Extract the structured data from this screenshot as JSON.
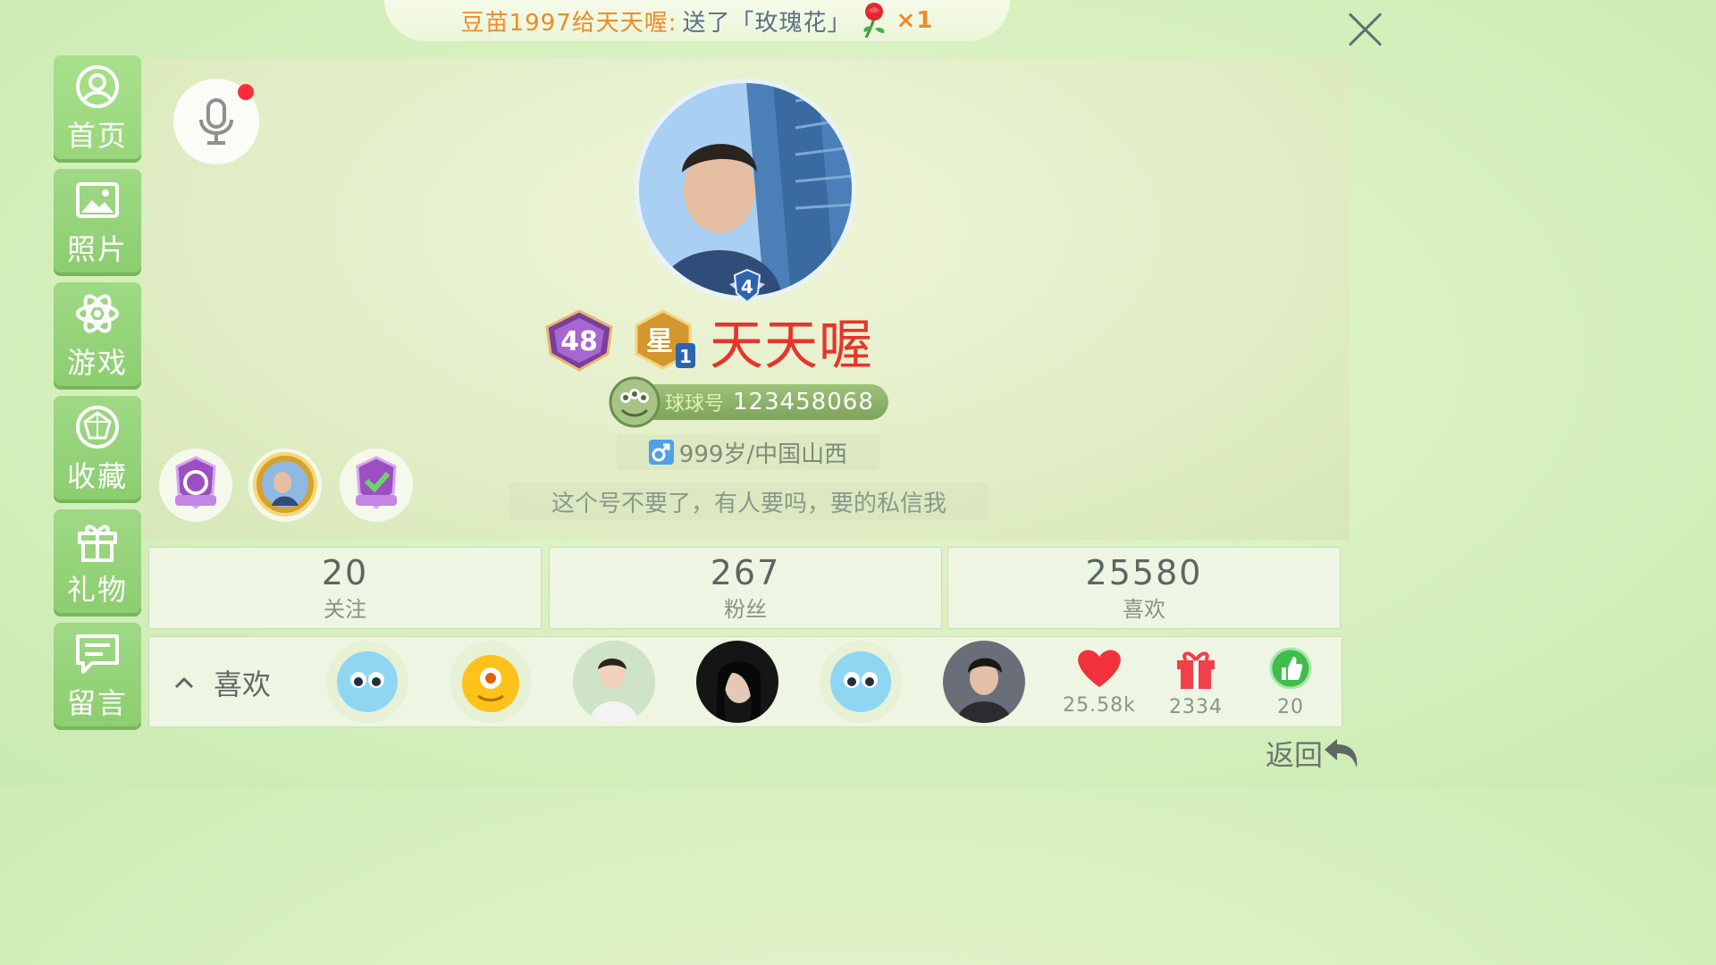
{
  "notice": {
    "sender": "豆苗1997给天天喔:",
    "action": "送了「玫瑰花」",
    "count": "×1"
  },
  "sidebar": {
    "items": [
      {
        "label": "首页",
        "icon": "home-icon"
      },
      {
        "label": "照片",
        "icon": "photo-icon"
      },
      {
        "label": "游戏",
        "icon": "atom-icon"
      },
      {
        "label": "收藏",
        "icon": "collection-icon"
      },
      {
        "label": "礼物",
        "icon": "gift-icon"
      },
      {
        "label": "留言",
        "icon": "message-icon"
      }
    ]
  },
  "profile": {
    "avatar_rank": "4",
    "level": "48",
    "star": "星",
    "star_level": "1",
    "username": "天天喔",
    "id_label": "球球号",
    "id_number": "123458068",
    "age_region": "999岁/中国山西",
    "bio": "这个号不要了，有人要吗，要的私信我"
  },
  "stats": [
    {
      "value": "20",
      "label": "关注"
    },
    {
      "value": "267",
      "label": "粉丝"
    },
    {
      "value": "25580",
      "label": "喜欢"
    }
  ],
  "likes_bar": {
    "label": "喜欢",
    "heart_count": "25.58k",
    "gift_count": "2334",
    "thumb_count": "20"
  },
  "back": {
    "label": "返回"
  },
  "colors": {
    "accent_green": "#8ccd6f",
    "username_red": "#e8352b",
    "notice_orange": "#f08a2a"
  }
}
